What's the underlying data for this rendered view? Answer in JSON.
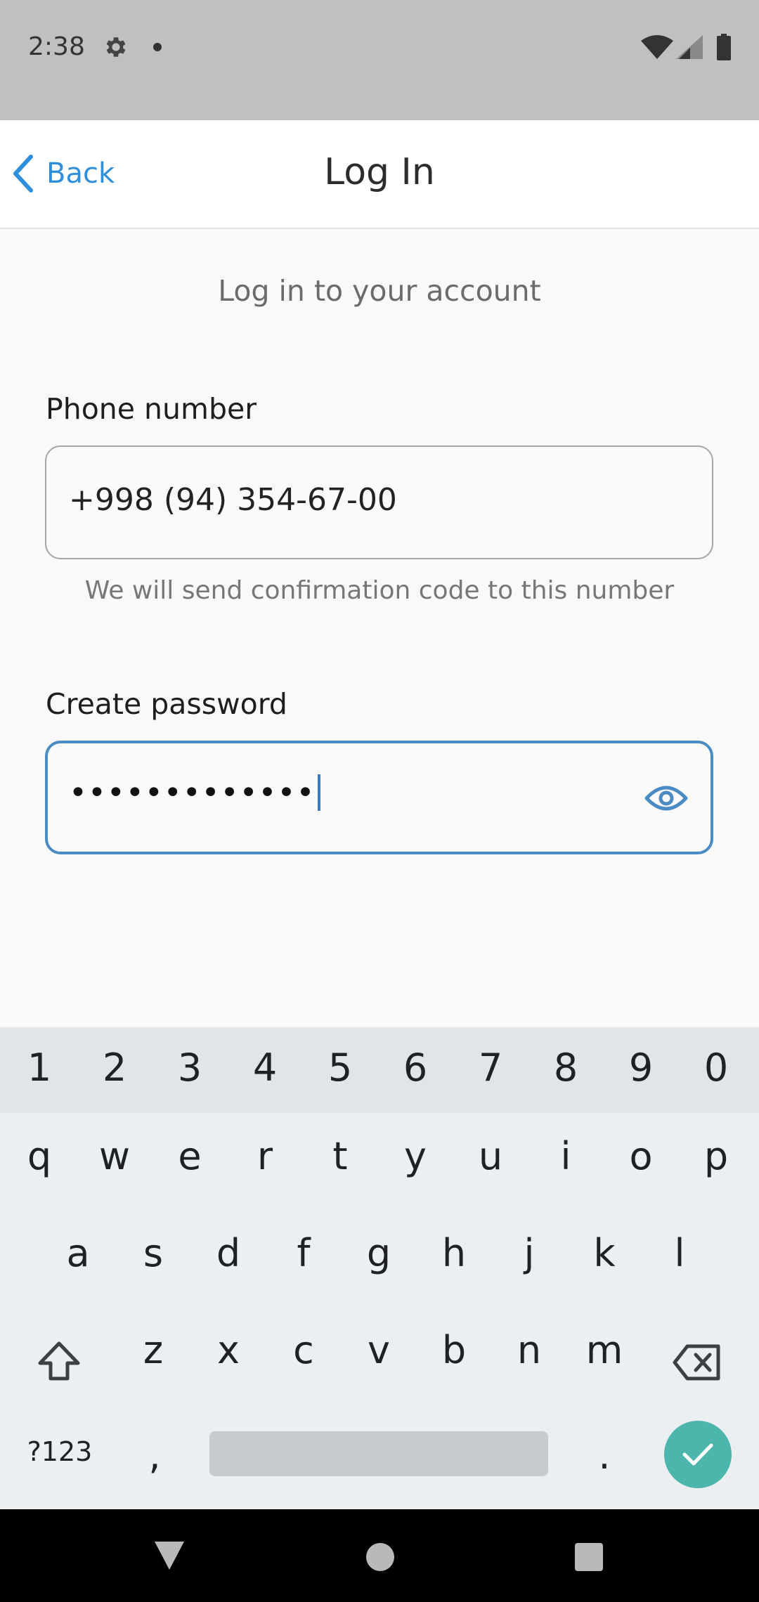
{
  "status_bar": {
    "time": "2:38",
    "icons": [
      "gear-icon",
      "notification-dot-icon",
      "wifi-icon",
      "signal-icon",
      "battery-icon"
    ]
  },
  "app_bar": {
    "back_label": "Back",
    "title": "Log In"
  },
  "form": {
    "subtitle": "Log in to your account",
    "phone": {
      "label": "Phone number",
      "value": "+998 (94) 354-67-00",
      "helper": "We will send confirmation code to this number"
    },
    "password": {
      "label": "Create password",
      "value": "•••••••••••••"
    }
  },
  "keyboard": {
    "number_row": [
      "1",
      "2",
      "3",
      "4",
      "5",
      "6",
      "7",
      "8",
      "9",
      "0"
    ],
    "row1": [
      "q",
      "w",
      "e",
      "r",
      "t",
      "y",
      "u",
      "i",
      "o",
      "p"
    ],
    "row2": [
      "a",
      "s",
      "d",
      "f",
      "g",
      "h",
      "j",
      "k",
      "l"
    ],
    "row3": [
      "z",
      "x",
      "c",
      "v",
      "b",
      "n",
      "m"
    ],
    "symbols_key": "?123",
    "comma_key": ",",
    "period_key": "."
  },
  "colors": {
    "accent": "#2f8fdc",
    "focus_border": "#4b8bc4",
    "enter_key": "#4db6ac",
    "status_bar": "#c0c0c0"
  }
}
